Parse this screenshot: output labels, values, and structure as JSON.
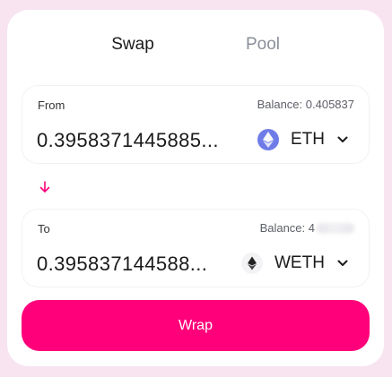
{
  "tabs": [
    {
      "label": "Swap",
      "active": true
    },
    {
      "label": "Pool",
      "active": false
    }
  ],
  "from": {
    "label": "From",
    "balance": "Balance: 0.405837",
    "amount": "0.3958371445885...",
    "token": {
      "symbol": "ETH",
      "icon": "eth-icon",
      "icon_color": "#6f7ce8"
    }
  },
  "swap_arrow_icon": "arrow-down-icon",
  "to": {
    "label": "To",
    "balance": "Balance: 4",
    "balance_redacted": true,
    "amount": "0.395837144588...",
    "token": {
      "symbol": "WETH",
      "icon": "weth-icon",
      "icon_color": "#f3f3f5"
    }
  },
  "action": {
    "label": "Wrap",
    "color": "#ff007a"
  },
  "colors": {
    "background": "#f7e4f0",
    "card": "#ffffff",
    "accent": "#ff007a"
  }
}
